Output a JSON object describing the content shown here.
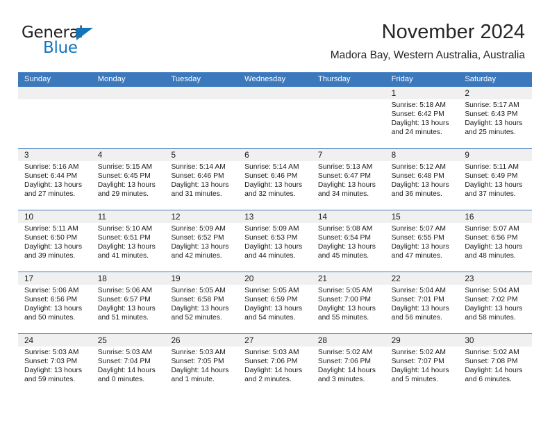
{
  "brand": {
    "name_top": "General",
    "name_bottom": "Blue",
    "color_dark": "#231f20",
    "color_blue": "#1275bc"
  },
  "header": {
    "title": "November 2024",
    "subtitle": "Madora Bay, Western Australia, Australia"
  },
  "theme": {
    "header_blue": "#3c78bc",
    "daynum_strip": "#f0f0f0",
    "text": "#1a1a1a"
  },
  "weekdays": [
    "Sunday",
    "Monday",
    "Tuesday",
    "Wednesday",
    "Thursday",
    "Friday",
    "Saturday"
  ],
  "weeks": [
    [
      {
        "day": "",
        "sunrise": "",
        "sunset": "",
        "daylight": "",
        "empty": true
      },
      {
        "day": "",
        "sunrise": "",
        "sunset": "",
        "daylight": "",
        "empty": true
      },
      {
        "day": "",
        "sunrise": "",
        "sunset": "",
        "daylight": "",
        "empty": true
      },
      {
        "day": "",
        "sunrise": "",
        "sunset": "",
        "daylight": "",
        "empty": true
      },
      {
        "day": "",
        "sunrise": "",
        "sunset": "",
        "daylight": "",
        "empty": true
      },
      {
        "day": "1",
        "sunrise": "Sunrise: 5:18 AM",
        "sunset": "Sunset: 6:42 PM",
        "daylight": "Daylight: 13 hours and 24 minutes."
      },
      {
        "day": "2",
        "sunrise": "Sunrise: 5:17 AM",
        "sunset": "Sunset: 6:43 PM",
        "daylight": "Daylight: 13 hours and 25 minutes."
      }
    ],
    [
      {
        "day": "3",
        "sunrise": "Sunrise: 5:16 AM",
        "sunset": "Sunset: 6:44 PM",
        "daylight": "Daylight: 13 hours and 27 minutes."
      },
      {
        "day": "4",
        "sunrise": "Sunrise: 5:15 AM",
        "sunset": "Sunset: 6:45 PM",
        "daylight": "Daylight: 13 hours and 29 minutes."
      },
      {
        "day": "5",
        "sunrise": "Sunrise: 5:14 AM",
        "sunset": "Sunset: 6:46 PM",
        "daylight": "Daylight: 13 hours and 31 minutes."
      },
      {
        "day": "6",
        "sunrise": "Sunrise: 5:14 AM",
        "sunset": "Sunset: 6:46 PM",
        "daylight": "Daylight: 13 hours and 32 minutes."
      },
      {
        "day": "7",
        "sunrise": "Sunrise: 5:13 AM",
        "sunset": "Sunset: 6:47 PM",
        "daylight": "Daylight: 13 hours and 34 minutes."
      },
      {
        "day": "8",
        "sunrise": "Sunrise: 5:12 AM",
        "sunset": "Sunset: 6:48 PM",
        "daylight": "Daylight: 13 hours and 36 minutes."
      },
      {
        "day": "9",
        "sunrise": "Sunrise: 5:11 AM",
        "sunset": "Sunset: 6:49 PM",
        "daylight": "Daylight: 13 hours and 37 minutes."
      }
    ],
    [
      {
        "day": "10",
        "sunrise": "Sunrise: 5:11 AM",
        "sunset": "Sunset: 6:50 PM",
        "daylight": "Daylight: 13 hours and 39 minutes."
      },
      {
        "day": "11",
        "sunrise": "Sunrise: 5:10 AM",
        "sunset": "Sunset: 6:51 PM",
        "daylight": "Daylight: 13 hours and 41 minutes."
      },
      {
        "day": "12",
        "sunrise": "Sunrise: 5:09 AM",
        "sunset": "Sunset: 6:52 PM",
        "daylight": "Daylight: 13 hours and 42 minutes."
      },
      {
        "day": "13",
        "sunrise": "Sunrise: 5:09 AM",
        "sunset": "Sunset: 6:53 PM",
        "daylight": "Daylight: 13 hours and 44 minutes."
      },
      {
        "day": "14",
        "sunrise": "Sunrise: 5:08 AM",
        "sunset": "Sunset: 6:54 PM",
        "daylight": "Daylight: 13 hours and 45 minutes."
      },
      {
        "day": "15",
        "sunrise": "Sunrise: 5:07 AM",
        "sunset": "Sunset: 6:55 PM",
        "daylight": "Daylight: 13 hours and 47 minutes."
      },
      {
        "day": "16",
        "sunrise": "Sunrise: 5:07 AM",
        "sunset": "Sunset: 6:56 PM",
        "daylight": "Daylight: 13 hours and 48 minutes."
      }
    ],
    [
      {
        "day": "17",
        "sunrise": "Sunrise: 5:06 AM",
        "sunset": "Sunset: 6:56 PM",
        "daylight": "Daylight: 13 hours and 50 minutes."
      },
      {
        "day": "18",
        "sunrise": "Sunrise: 5:06 AM",
        "sunset": "Sunset: 6:57 PM",
        "daylight": "Daylight: 13 hours and 51 minutes."
      },
      {
        "day": "19",
        "sunrise": "Sunrise: 5:05 AM",
        "sunset": "Sunset: 6:58 PM",
        "daylight": "Daylight: 13 hours and 52 minutes."
      },
      {
        "day": "20",
        "sunrise": "Sunrise: 5:05 AM",
        "sunset": "Sunset: 6:59 PM",
        "daylight": "Daylight: 13 hours and 54 minutes."
      },
      {
        "day": "21",
        "sunrise": "Sunrise: 5:05 AM",
        "sunset": "Sunset: 7:00 PM",
        "daylight": "Daylight: 13 hours and 55 minutes."
      },
      {
        "day": "22",
        "sunrise": "Sunrise: 5:04 AM",
        "sunset": "Sunset: 7:01 PM",
        "daylight": "Daylight: 13 hours and 56 minutes."
      },
      {
        "day": "23",
        "sunrise": "Sunrise: 5:04 AM",
        "sunset": "Sunset: 7:02 PM",
        "daylight": "Daylight: 13 hours and 58 minutes."
      }
    ],
    [
      {
        "day": "24",
        "sunrise": "Sunrise: 5:03 AM",
        "sunset": "Sunset: 7:03 PM",
        "daylight": "Daylight: 13 hours and 59 minutes."
      },
      {
        "day": "25",
        "sunrise": "Sunrise: 5:03 AM",
        "sunset": "Sunset: 7:04 PM",
        "daylight": "Daylight: 14 hours and 0 minutes."
      },
      {
        "day": "26",
        "sunrise": "Sunrise: 5:03 AM",
        "sunset": "Sunset: 7:05 PM",
        "daylight": "Daylight: 14 hours and 1 minute."
      },
      {
        "day": "27",
        "sunrise": "Sunrise: 5:03 AM",
        "sunset": "Sunset: 7:06 PM",
        "daylight": "Daylight: 14 hours and 2 minutes."
      },
      {
        "day": "28",
        "sunrise": "Sunrise: 5:02 AM",
        "sunset": "Sunset: 7:06 PM",
        "daylight": "Daylight: 14 hours and 3 minutes."
      },
      {
        "day": "29",
        "sunrise": "Sunrise: 5:02 AM",
        "sunset": "Sunset: 7:07 PM",
        "daylight": "Daylight: 14 hours and 5 minutes."
      },
      {
        "day": "30",
        "sunrise": "Sunrise: 5:02 AM",
        "sunset": "Sunset: 7:08 PM",
        "daylight": "Daylight: 14 hours and 6 minutes."
      }
    ]
  ]
}
